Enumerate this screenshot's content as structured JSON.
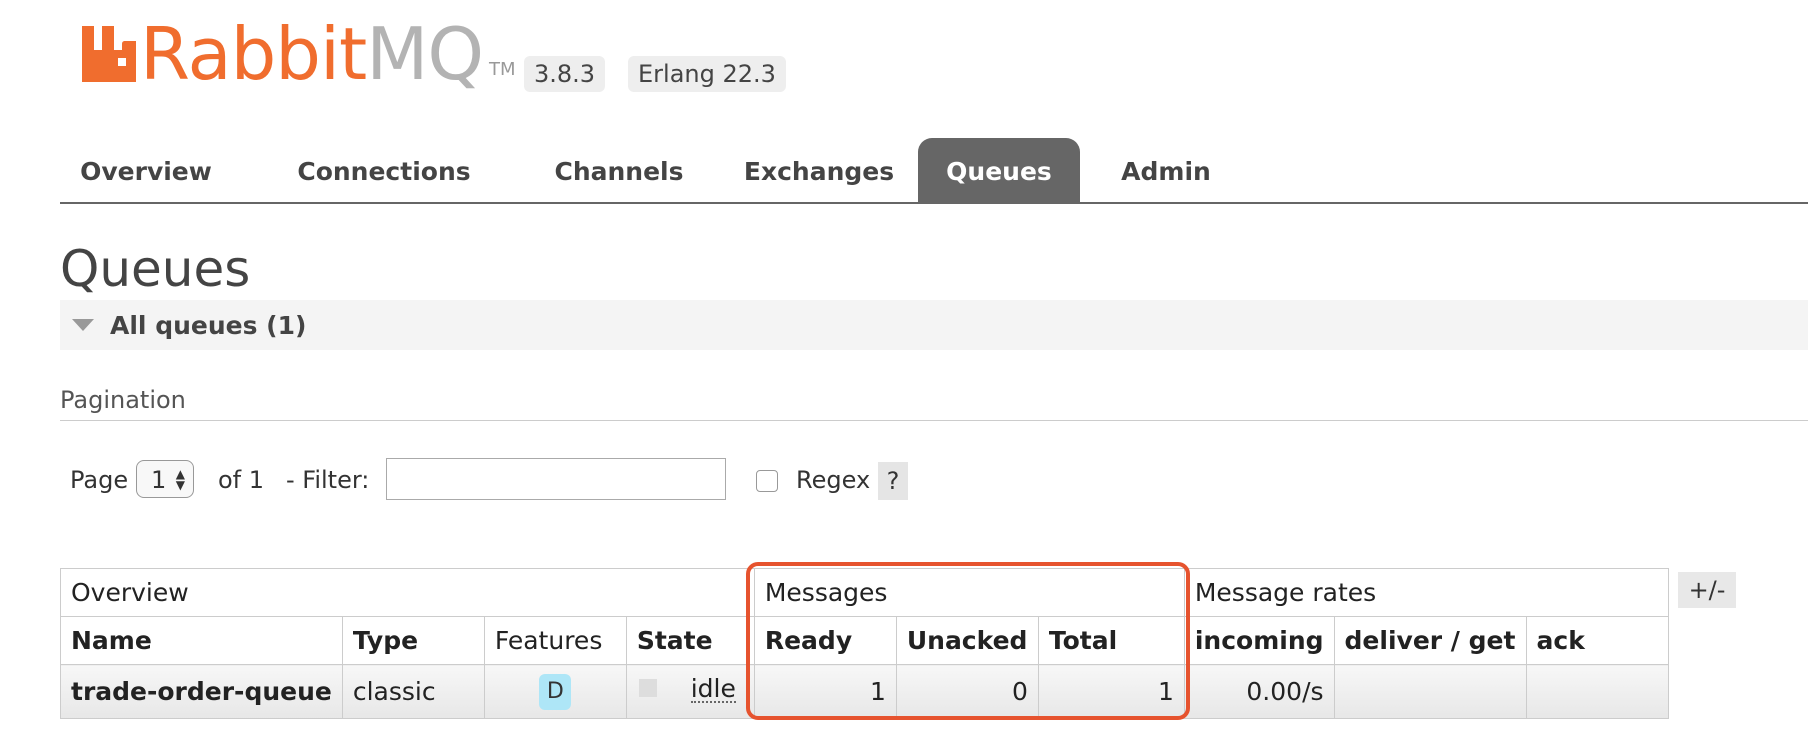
{
  "header": {
    "logo_primary": "Rabbit",
    "logo_secondary": "MQ",
    "logo_tm": "TM",
    "version": "3.8.3",
    "erlang": "Erlang 22.3"
  },
  "nav": {
    "tabs": [
      "Overview",
      "Connections",
      "Channels",
      "Exchanges",
      "Queues",
      "Admin"
    ],
    "active": "Queues"
  },
  "page": {
    "title": "Queues",
    "section": "All queues (1)"
  },
  "pagination": {
    "label": "Pagination",
    "page_label": "Page",
    "page_value": "1",
    "of_label": "of 1",
    "filter_label": "- Filter:",
    "filter_value": "",
    "regex_label": "Regex",
    "help_label": "?"
  },
  "table": {
    "groups": {
      "overview": "Overview",
      "messages": "Messages",
      "rates": "Message rates"
    },
    "columns": {
      "name": "Name",
      "type": "Type",
      "features": "Features",
      "state": "State",
      "ready": "Ready",
      "unacked": "Unacked",
      "total": "Total",
      "incoming": "incoming",
      "deliver": "deliver / get",
      "ack": "ack"
    },
    "rows": [
      {
        "name": "trade-order-queue",
        "type": "classic",
        "features": "D",
        "state": "idle",
        "ready": "1",
        "unacked": "0",
        "total": "1",
        "incoming": "0.00/s",
        "deliver": "",
        "ack": ""
      }
    ],
    "toggle_label": "+/-"
  },
  "colors": {
    "brand_orange": "#f06d2e",
    "active_tab": "#666666",
    "highlight": "#e6532e",
    "feature_badge": "#aee6f7"
  }
}
